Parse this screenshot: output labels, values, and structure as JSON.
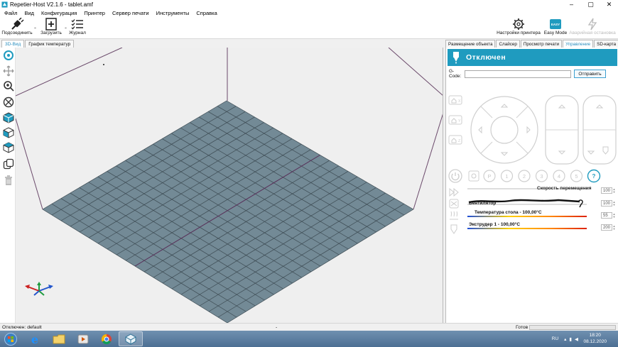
{
  "window": {
    "title": "Repetier-Host V2.1.6 - tablet.amf",
    "minimize": "–",
    "maximize": "▢",
    "close": "✕"
  },
  "menu": [
    "Файл",
    "Вид",
    "Конфигурация",
    "Принтер",
    "Сервер печати",
    "Инструменты",
    "Справка"
  ],
  "toolbar": {
    "connect": "Подсоединить",
    "load": "Загрузить",
    "log": "Журнал",
    "printer_settings": "Настройки принтера",
    "easy_mode": "Easy Mode",
    "easy_badge": "EASY",
    "emergency_stop": "Аварийная остановка"
  },
  "view_tabs": [
    "3D-Вид",
    "График температур"
  ],
  "right_tabs": [
    "Размещение объекта",
    "Слайсер",
    "Просмотр печати",
    "Управление",
    "SD-карта"
  ],
  "control": {
    "status": "Отключен",
    "gcode_label": "G-Code:",
    "gcode_value": "",
    "send_label": "Отправить",
    "home_labels": [
      "X",
      "Y",
      "Z"
    ],
    "buttons": [
      "P",
      "1",
      "2",
      "3",
      "4",
      "5",
      "?"
    ],
    "speed_label": "Скорость перемещения",
    "speed_value": "100",
    "fan_label": "Вентилятор",
    "fan_value": "100",
    "bed_label": "Температура стола - 100,00°C",
    "bed_value": "55",
    "extruder_label": "Экструдер 1 - 100,00°C",
    "extruder_value": "200"
  },
  "statusbar": {
    "connection": "Отключен: default",
    "middle": "-",
    "ready": "Готов"
  },
  "taskbar": {
    "lang": "RU",
    "time": "18:20",
    "date": "08.12.2020"
  },
  "colors": {
    "accent": "#1f9bbf",
    "grid_fill": "#738a96",
    "grid_line": "#3c4a52"
  }
}
